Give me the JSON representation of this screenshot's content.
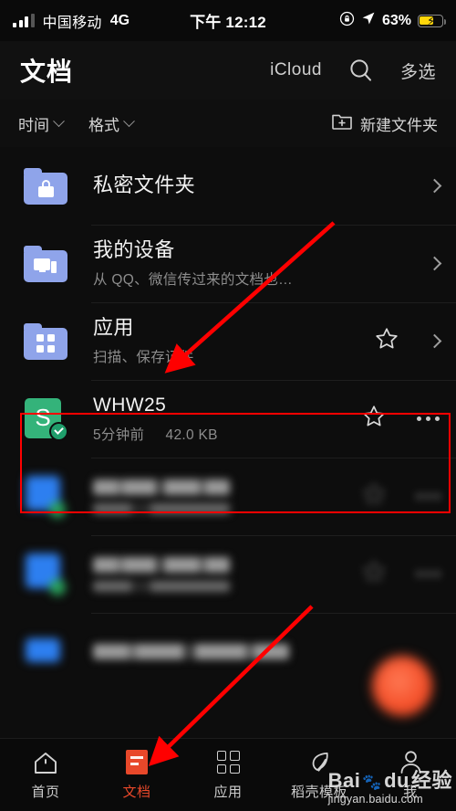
{
  "status_bar": {
    "carrier": "中国移动",
    "network": "4G",
    "time": "下午 12:12",
    "battery_percent": "63%",
    "battery_level": 63,
    "signal_icon": "signal-bars-icon",
    "rotation_lock_icon": "rotation-lock-icon",
    "location_icon": "location-arrow-icon",
    "battery_icon": "battery-charging-icon"
  },
  "header": {
    "title": "文档",
    "icloud_label": "iCloud",
    "search_icon": "search-icon",
    "multiselect_label": "多选"
  },
  "filter_bar": {
    "sort_label": "时间",
    "format_label": "格式",
    "new_folder_label": "新建文件夹",
    "new_folder_icon": "folder-plus-icon"
  },
  "list": {
    "rows": [
      {
        "title": "私密文件夹",
        "subtitle": "",
        "icon": "folder-lock-icon",
        "icon_type": "folder-lock",
        "has_star": false,
        "trailing": "chevron",
        "blurred": false
      },
      {
        "title": "我的设备",
        "subtitle": "从 QQ、微信传过来的文档也…",
        "icon": "folder-devices-icon",
        "icon_type": "folder-devices",
        "has_star": false,
        "trailing": "chevron",
        "blurred": false
      },
      {
        "title": "应用",
        "subtitle": "扫描、保存证件",
        "icon": "folder-apps-icon",
        "icon_type": "folder-grid",
        "has_star": true,
        "trailing": "chevron",
        "blurred": false
      },
      {
        "title": "WHW25",
        "subtitle_time": "5分钟前",
        "subtitle_size": "42.0 KB",
        "icon": "spreadsheet-file-icon",
        "icon_type": "sheet",
        "has_star": true,
        "trailing": "more",
        "blurred": false,
        "highlighted": true
      },
      {
        "title": "",
        "subtitle": "",
        "icon": "blurred-file-icon",
        "icon_type": "blurred",
        "has_star": true,
        "trailing": "more",
        "blurred": true
      },
      {
        "title": "",
        "subtitle": "",
        "icon": "blurred-file-icon",
        "icon_type": "blurred",
        "has_star": true,
        "trailing": "more",
        "blurred": true
      },
      {
        "title": "",
        "subtitle": "",
        "icon": "blurred-file-icon",
        "icon_type": "blurred-narrow",
        "has_star": false,
        "trailing": "none",
        "blurred": true
      }
    ]
  },
  "fab": {
    "name": "new-document-fab",
    "color": "#f4502a"
  },
  "bottom_nav": {
    "items": [
      {
        "label": "首页",
        "icon": "home-icon",
        "active": false
      },
      {
        "label": "文档",
        "icon": "document-icon",
        "active": true
      },
      {
        "label": "应用",
        "icon": "apps-grid-icon",
        "active": false
      },
      {
        "label": "稻壳模板",
        "icon": "leaf-icon",
        "active": false
      },
      {
        "label": "我",
        "icon": "person-icon",
        "active": false
      }
    ],
    "active_color": "#e8482a"
  },
  "annotations": {
    "highlight_color": "#ff0000",
    "arrow_count": 2,
    "arrow_1_target": "应用",
    "arrow_2_target": "文档"
  },
  "watermark": {
    "brand": "Bai",
    "brand2": "du",
    "suffix": "经验",
    "url": "jingyan.baidu.com"
  }
}
